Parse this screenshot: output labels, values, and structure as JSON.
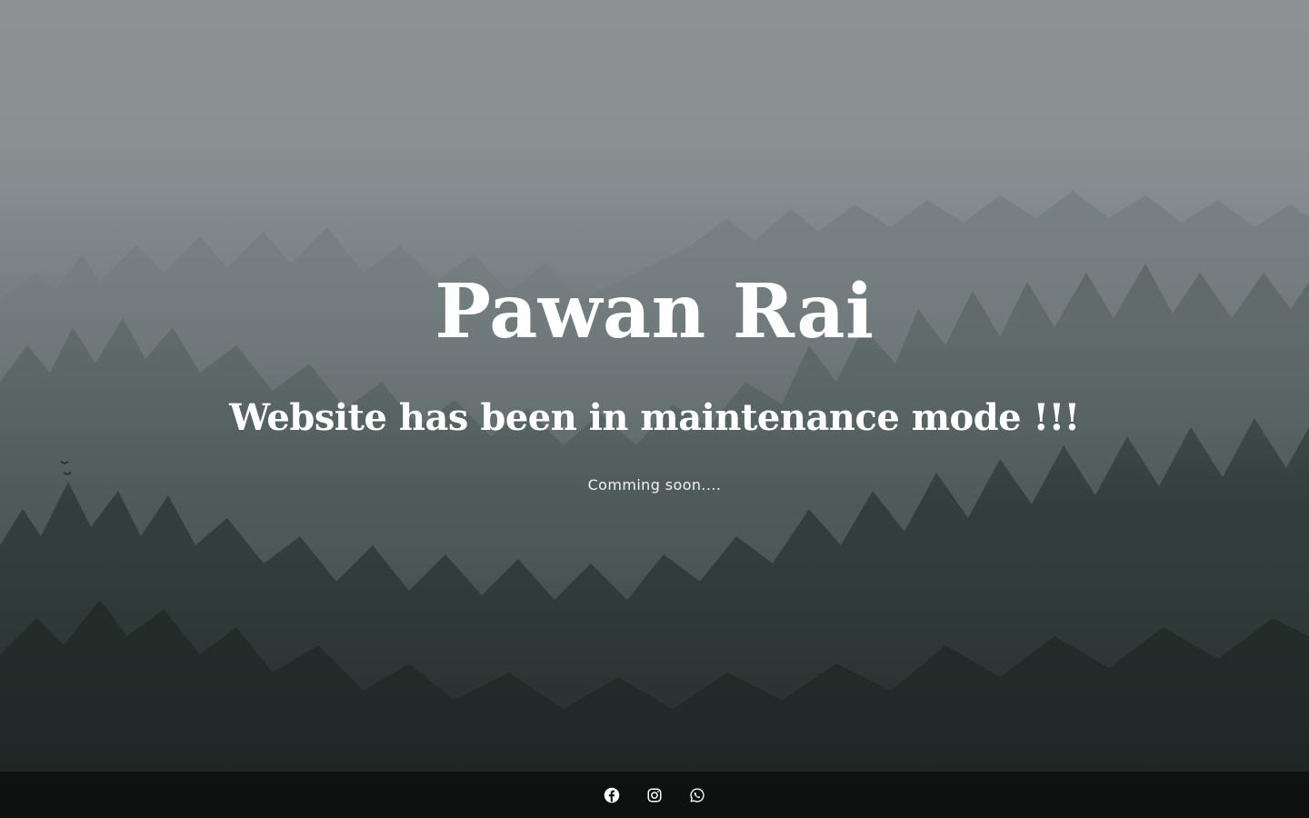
{
  "site": {
    "title": "Pawan Rai",
    "headline": "Website has been in maintenance mode !!!",
    "subtext": "Comming soon...."
  },
  "footer": {
    "social_links": [
      {
        "icon": "facebook-icon"
      },
      {
        "icon": "instagram-icon"
      },
      {
        "icon": "whatsapp-icon"
      }
    ]
  },
  "colors": {
    "text": "#ffffff",
    "footer_background": "#0c0e0e",
    "icon": "#ffffff"
  }
}
